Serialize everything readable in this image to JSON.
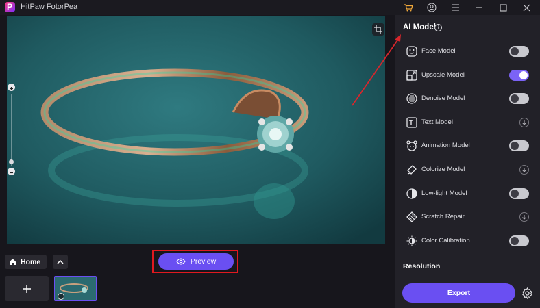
{
  "app": {
    "title": "HitPaw FotorPea"
  },
  "bottom": {
    "home_label": "Home",
    "preview_label": "Preview"
  },
  "panel": {
    "title": "AI Model",
    "models": [
      {
        "label": "Face Model",
        "icon": "face-icon",
        "control": "toggle",
        "on": false
      },
      {
        "label": "Upscale Model",
        "icon": "upscale-icon",
        "control": "toggle",
        "on": true
      },
      {
        "label": "Denoise Model",
        "icon": "denoise-icon",
        "control": "toggle",
        "on": false
      },
      {
        "label": "Text Model",
        "icon": "text-icon",
        "control": "expand"
      },
      {
        "label": "Animation Model",
        "icon": "animation-icon",
        "control": "toggle",
        "on": false
      },
      {
        "label": "Colorize Model",
        "icon": "colorize-icon",
        "control": "expand"
      },
      {
        "label": "Low-light Model",
        "icon": "low-light-icon",
        "control": "toggle",
        "on": false
      },
      {
        "label": "Scratch Repair",
        "icon": "scratch-icon",
        "control": "expand"
      },
      {
        "label": "Color Calibration",
        "icon": "color-calibration-icon",
        "control": "toggle",
        "on": false
      }
    ],
    "resolution_label": "Resolution",
    "export_label": "Export"
  },
  "colors": {
    "accent": "#6a4ff2",
    "toggle_on": "#7b63f6",
    "highlight": "#e0191f",
    "background": "#17161c",
    "panel": "#222128"
  }
}
